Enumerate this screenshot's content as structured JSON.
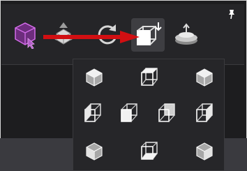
{
  "toolbar": {
    "items": [
      {
        "name": "select-tool",
        "icon": "cube-cursor-icon"
      },
      {
        "name": "move-tool",
        "icon": "move-cube-icon"
      },
      {
        "name": "rotate-tool",
        "icon": "rotate-icon"
      },
      {
        "name": "view-orientation",
        "icon": "wireframe-cube-arrow-icon"
      },
      {
        "name": "orbit-tool",
        "icon": "orbit-layers-icon"
      }
    ],
    "pin_icon": "pin-icon"
  },
  "dropdown": {
    "rows": [
      [
        "iso-top-left",
        "front-top",
        "iso-top-right"
      ],
      [
        "left",
        "front",
        "back",
        "right"
      ],
      [
        "iso-bottom-left",
        "front-bottom",
        "iso-bottom-right"
      ]
    ]
  },
  "colors": {
    "accent_purple": "#b35cc8",
    "arrow_red": "#d10f12",
    "background": "#1d1d1f",
    "toolbar": "#252528"
  }
}
